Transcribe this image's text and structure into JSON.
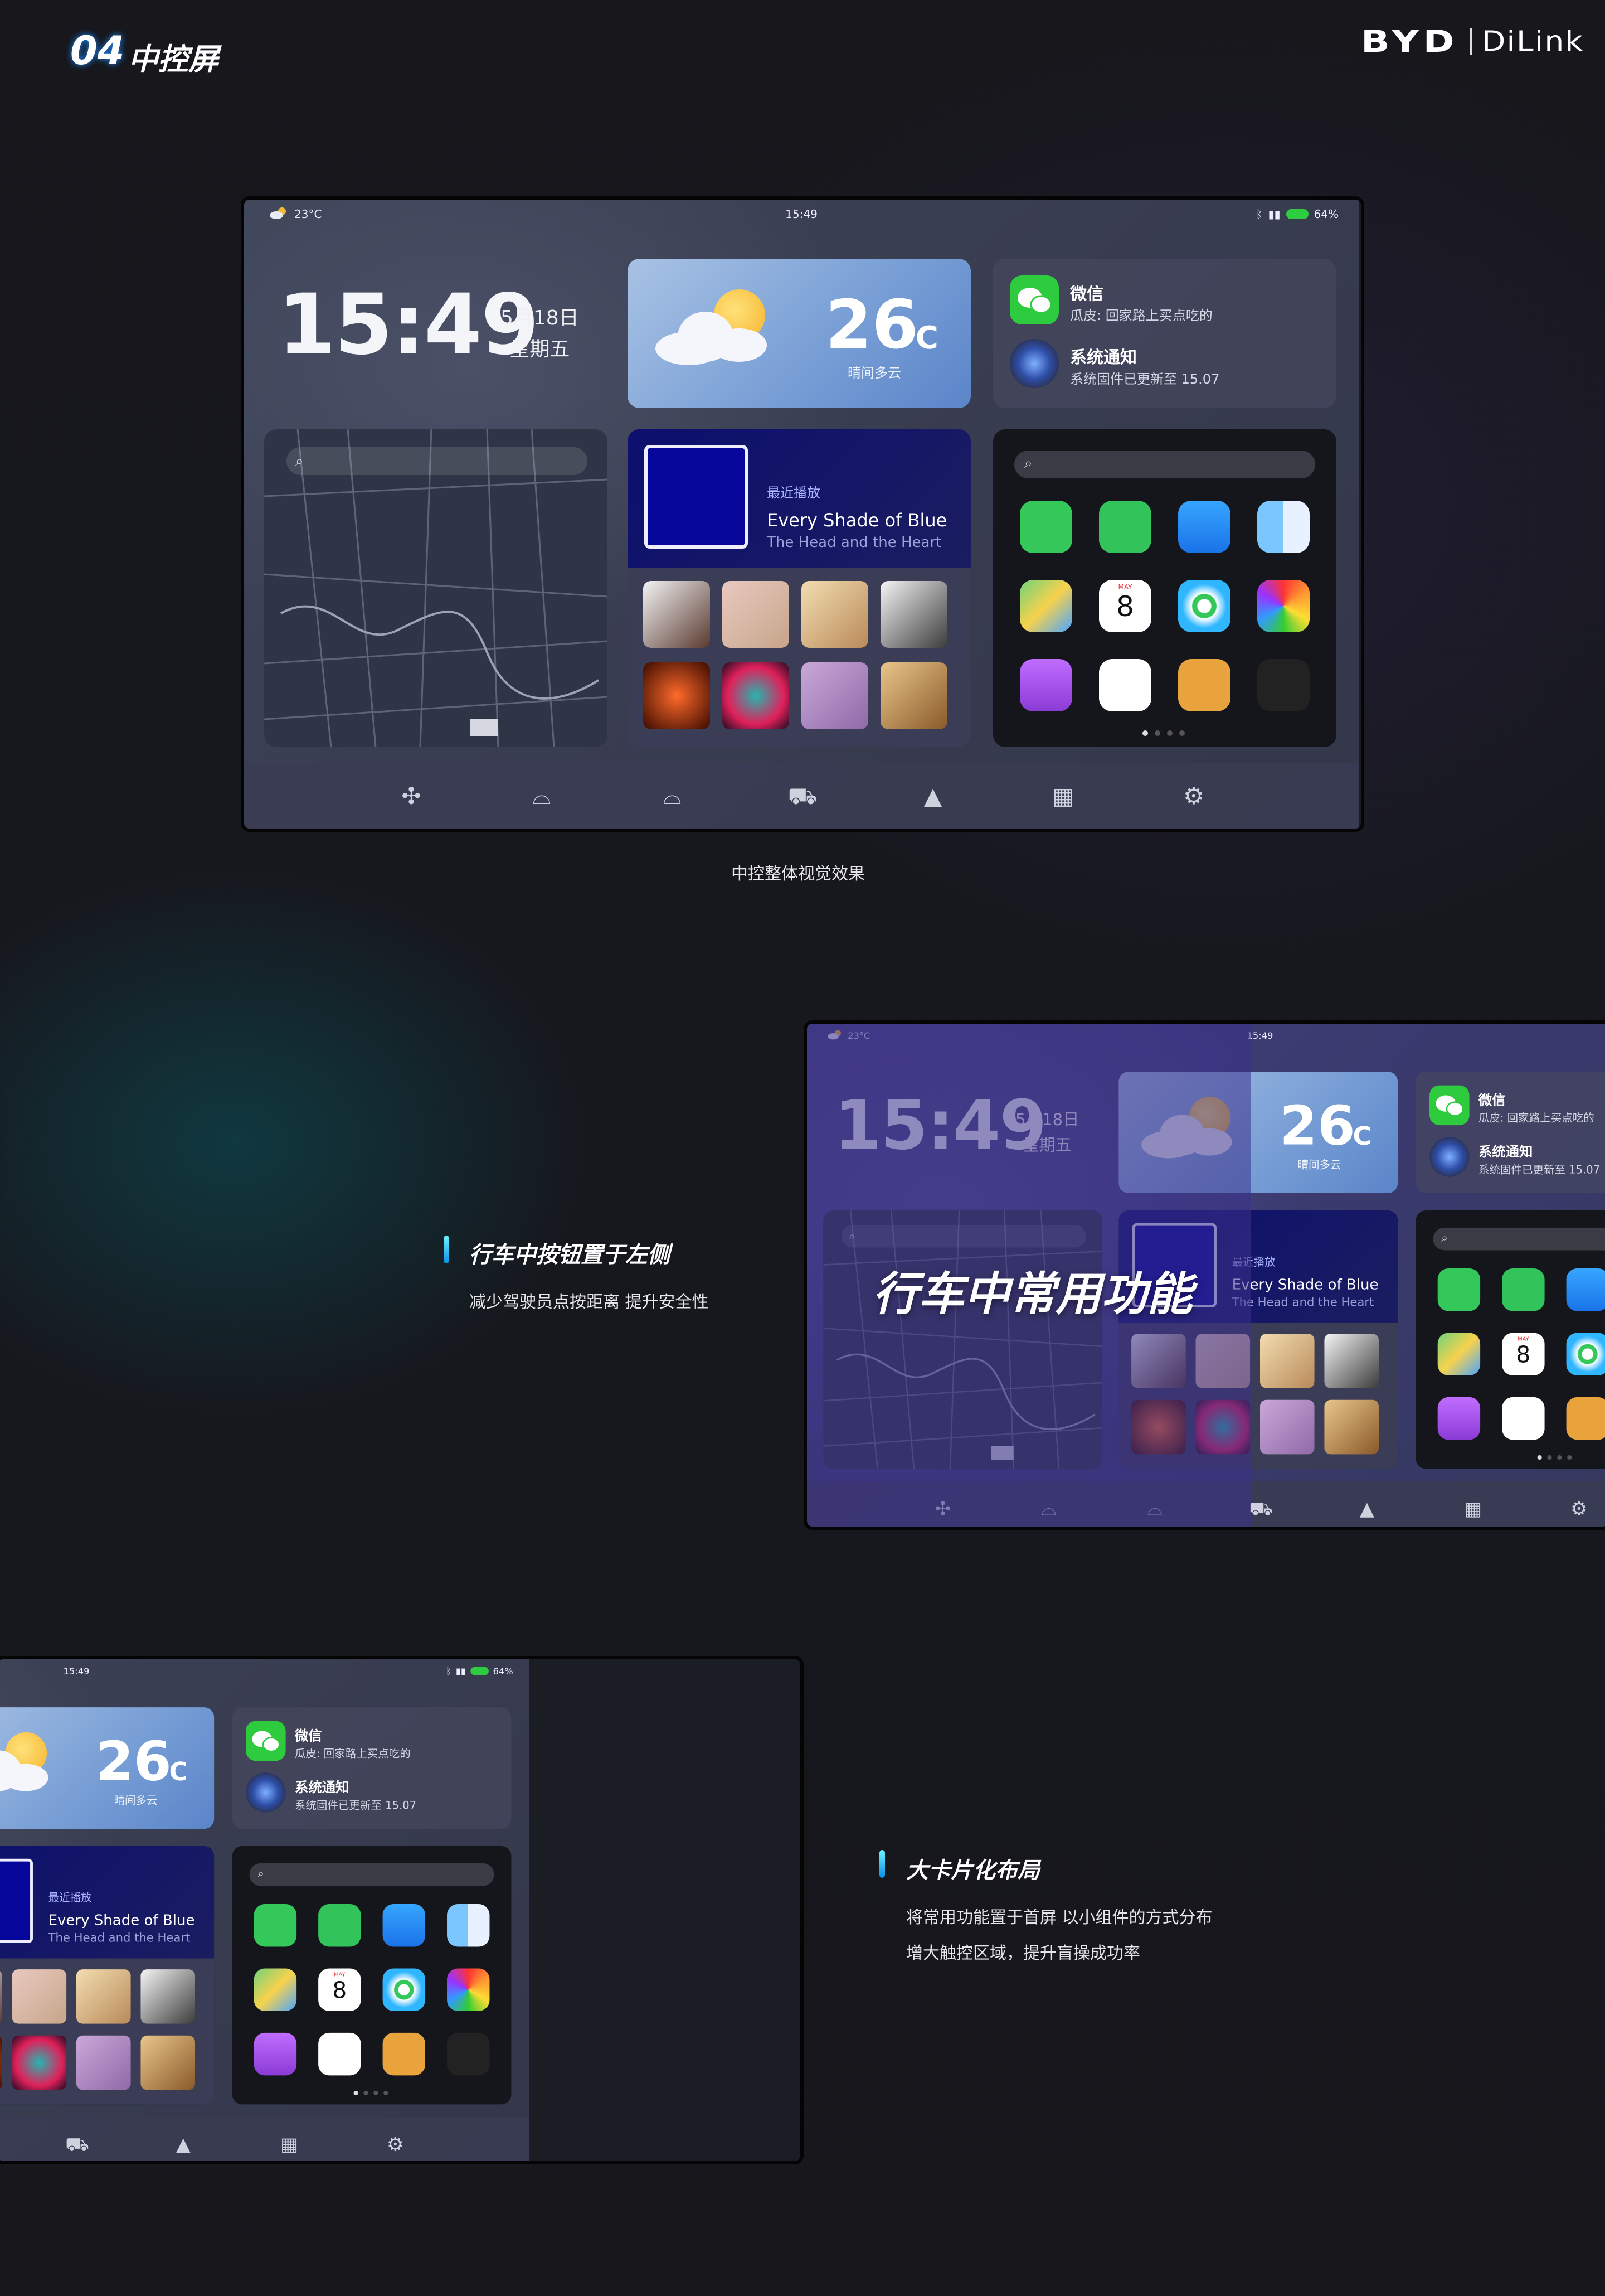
{
  "header": {
    "section_no": "04",
    "section_title": "中控屏"
  },
  "logo": {
    "brand": "BYD",
    "product": "DiLink"
  },
  "screen": {
    "status_temp": "23°C",
    "status_time": "15:49",
    "battery": "64%",
    "clock": "15:49",
    "date": "5月18日",
    "weekday": "星期五",
    "weather": {
      "temp": "26",
      "unit": "℃",
      "condition": "晴间多云"
    },
    "notifications": [
      {
        "app": "微信",
        "text": "瓜皮: 回家路上买点吃的",
        "icon": "wechat-icon"
      },
      {
        "app": "系统通知",
        "text": "系统固件已更新至 15.07",
        "icon": "system-notification-icon"
      }
    ],
    "music": {
      "recent_label": "最近播放",
      "song": "Every Shade of Blue",
      "artist": "The Head and the Heart"
    },
    "dock": [
      "fan-icon",
      "rear-defrost-icon",
      "front-defrost-icon",
      "car-icon",
      "navigation-icon",
      "apps-grid-icon",
      "settings-icon"
    ],
    "apps": [
      "messages-icon",
      "facetime-icon",
      "mail-icon",
      "finder-icon",
      "maps-icon",
      "calendar-icon",
      "find-my-icon",
      "photos-icon",
      "podcasts-icon",
      "reminders-icon",
      "contacts-icon",
      "voice-memos-icon"
    ],
    "calendar": {
      "month": "MAY",
      "day": "8"
    }
  },
  "captions": {
    "overall": "中控整体视觉效果",
    "driving_title": "行车中按钮置于左侧",
    "driving_desc": "减少驾驶员点按距离 提升安全性",
    "overlay": "行车中常用功能",
    "cards_title": "大卡片化布局",
    "cards_desc1": "将常用功能置于首屏 以小组件的方式分布",
    "cards_desc2": "增大触控区域，提升盲操成功率"
  },
  "colors": {
    "accent": "#19b6ef",
    "wechat": "#2fcb3f",
    "weather_card": "#7aa0d6",
    "music_card": "#1a2052",
    "battery": "#2ecc40"
  }
}
